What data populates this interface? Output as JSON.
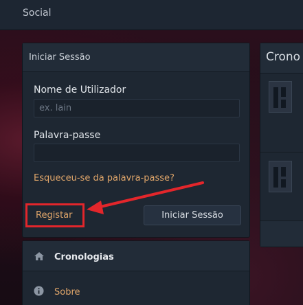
{
  "topbar": {
    "social_label": "Social"
  },
  "login": {
    "title": "Iniciar Sessão",
    "username_label": "Nome de Utilizador",
    "username_placeholder": "ex. lain",
    "username_value": "",
    "password_label": "Palavra-passe",
    "password_value": "",
    "forgot_link": "Esqueceu-se da palavra-passe?",
    "register_link": "Registar",
    "signin_button": "Iniciar Sessão"
  },
  "menu": {
    "items": [
      {
        "label": "Cronologias",
        "icon": "home-icon"
      },
      {
        "label": "Sobre",
        "icon": "info-icon"
      }
    ]
  },
  "right_panel": {
    "title": "Crono"
  },
  "colors": {
    "accent_link": "#e0a66a",
    "highlight_box": "#e3262b"
  }
}
